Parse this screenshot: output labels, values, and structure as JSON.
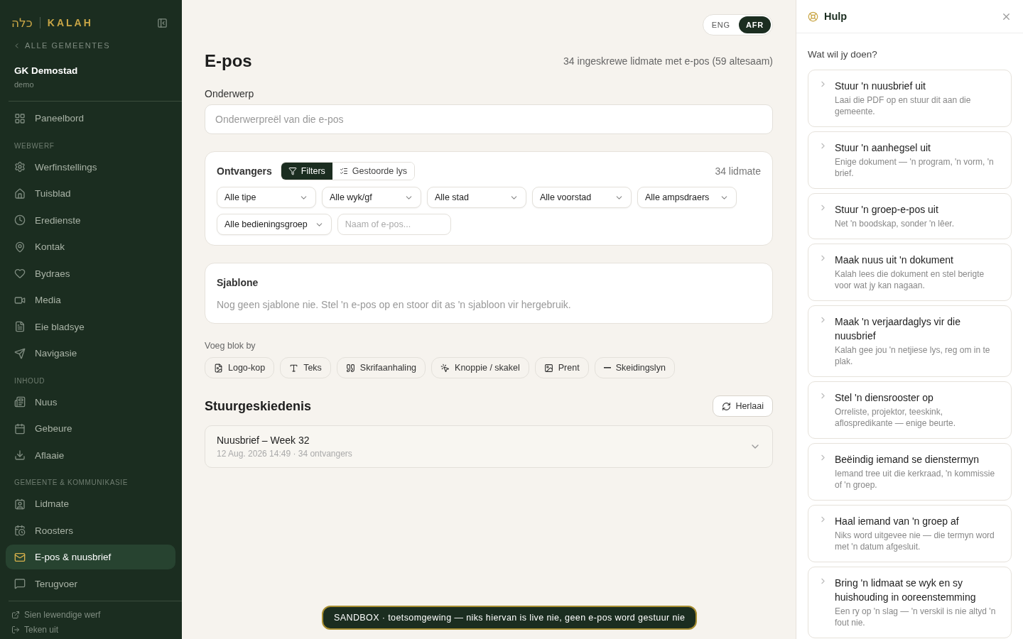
{
  "sidebar": {
    "logo_hebrew": "כלה",
    "logo_text": "KALAH",
    "back_link": "ALLE GEMEENTES",
    "congregation": "GK Demostad",
    "slug": "demo",
    "nav": [
      {
        "kind": "item",
        "label": "Paneelbord",
        "selected": false
      },
      {
        "kind": "heading",
        "label": "WEBWERF"
      },
      {
        "kind": "item",
        "label": "Werfinstellings",
        "selected": false
      },
      {
        "kind": "item",
        "label": "Tuisblad",
        "selected": false
      },
      {
        "kind": "item",
        "label": "Eredienste",
        "selected": false
      },
      {
        "kind": "item",
        "label": "Kontak",
        "selected": false
      },
      {
        "kind": "item",
        "label": "Bydraes",
        "selected": false
      },
      {
        "kind": "item",
        "label": "Media",
        "selected": false
      },
      {
        "kind": "item",
        "label": "Eie bladsye",
        "selected": false
      },
      {
        "kind": "item",
        "label": "Navigasie",
        "selected": false
      },
      {
        "kind": "heading",
        "label": "INHOUD"
      },
      {
        "kind": "item",
        "label": "Nuus",
        "selected": false
      },
      {
        "kind": "item",
        "label": "Gebeure",
        "selected": false
      },
      {
        "kind": "item",
        "label": "Aflaaie",
        "selected": false
      },
      {
        "kind": "heading",
        "label": "GEMEENTE & KOMMUNIKASIE"
      },
      {
        "kind": "item",
        "label": "Lidmate",
        "selected": false
      },
      {
        "kind": "item",
        "label": "Roosters",
        "selected": false
      },
      {
        "kind": "item",
        "label": "E-pos & nuusbrief",
        "selected": true
      },
      {
        "kind": "item",
        "label": "Terugvoer",
        "selected": false
      }
    ],
    "footer_links": [
      "Sien lewendige werf",
      "Teken uit"
    ]
  },
  "language_toggle": [
    {
      "label": "ENG",
      "selected": false
    },
    {
      "label": "AFR",
      "selected": true
    }
  ],
  "page": {
    "title": "E-pos",
    "summary": "34 ingeskrewe lidmate met e-pos (59 altesaam)"
  },
  "subject": {
    "label": "Onderwerp",
    "placeholder": "Onderwerpreël van die e-pos"
  },
  "recipients": {
    "title": "Ontvangers",
    "modes": [
      {
        "label": "Filters",
        "selected": true
      },
      {
        "label": "Gestoorde lys",
        "selected": false
      }
    ],
    "count": "34 lidmate",
    "filters": [
      "Alle tipe",
      "Alle wyk/gf",
      "Alle stad",
      "Alle voorstad",
      "Alle ampsdraers",
      "Alle bedieningsgroep"
    ],
    "search": {
      "placeholder": "Naam of e-pos..."
    }
  },
  "templates": {
    "title": "Sjablone",
    "empty": "Nog geen sjablone nie. Stel 'n e-pos op en stoor dit as 'n sjabloon vir hergebruik."
  },
  "add_block": {
    "label": "Voeg blok by",
    "blocks": [
      "Logo-kop",
      "Teks",
      "Skrifaanhaling",
      "Knoppie / skakel",
      "Prent",
      "Skeidingslyn"
    ]
  },
  "history": {
    "title": "Stuurgeskiedenis",
    "reload": "Herlaai",
    "entries": [
      {
        "title": "Nuusbrief – Week 32",
        "meta": "12 Aug. 2026 14:49 · 34 ontvangers",
        "expanded": false
      }
    ]
  },
  "help": {
    "title": "Hulp",
    "prompt": "Wat wil jy doen?",
    "items": [
      {
        "title": "Stuur 'n nuusbrief uit",
        "description": "Laai die PDF op en stuur dit aan die gemeente."
      },
      {
        "title": "Stuur 'n aanhegsel uit",
        "description": "Enige dokument — 'n program, 'n vorm, 'n brief."
      },
      {
        "title": "Stuur 'n groep-e-pos uit",
        "description": "Net 'n boodskap, sonder 'n lêer."
      },
      {
        "title": "Maak nuus uit 'n dokument",
        "description": "Kalah lees die dokument en stel berigte voor wat jy kan nagaan."
      },
      {
        "title": "Maak 'n verjaardaglys vir die nuusbrief",
        "description": "Kalah gee jou 'n netjiese lys, reg om in te plak."
      },
      {
        "title": "Stel 'n diensrooster op",
        "description": "Orreliste, projektor, teeskink, aflospredikante — enige beurte."
      },
      {
        "title": "Beëindig iemand se dienstermyn",
        "description": "Iemand tree uit die kerkraad, 'n kommissie of 'n groep."
      },
      {
        "title": "Haal iemand van 'n groep af",
        "description": "Niks word uitgevee nie — die termyn word met 'n datum afgesluit."
      },
      {
        "title": "Bring 'n lidmaat se wyk en sy huishouding in ooreenstemming",
        "description": "Een ry op 'n slag — 'n verskil is nie altyd 'n fout nie."
      }
    ]
  },
  "banner": "SANDBOX · toetsomgewing — niks hiervan is live nie, geen e-pos word gestuur nie"
}
